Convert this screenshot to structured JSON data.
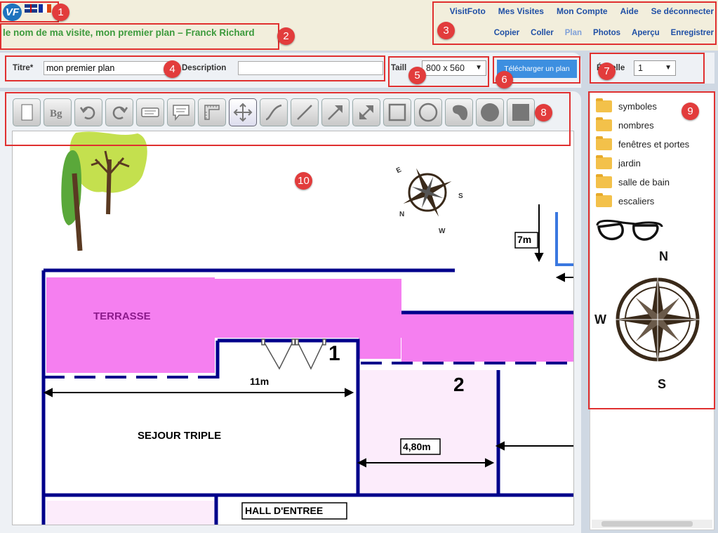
{
  "header": {
    "visit_title": "le nom de ma visite, mon premier plan – Franck Richard",
    "nav_top": [
      "VisitFoto",
      "Mes Visites",
      "Mon Compte",
      "Aide",
      "Se déconnecter"
    ],
    "nav_bottom": [
      "Copier",
      "Coller",
      "Plan",
      "Photos",
      "Aperçu",
      "Enregistrer"
    ],
    "active_nav": "Plan"
  },
  "form": {
    "title_label": "Titre*",
    "title_value": "mon premier plan",
    "description_label": "Description",
    "description_value": "",
    "size_label": "Taill",
    "size_value": "800 x 560",
    "upload_button": "Télécharger un plan",
    "scale_label": "Échelle",
    "scale_value": "1"
  },
  "toolbar": {
    "tools": [
      "blank-page-icon",
      "background-bg-icon",
      "undo-icon",
      "redo-icon",
      "text-box-icon",
      "speech-bubble-icon",
      "ruler-icon",
      "move-icon",
      "curve-icon",
      "line-icon",
      "arrow-icon",
      "double-arrow-icon",
      "square-icon",
      "circle-icon",
      "blob-shape-icon",
      "filled-circle-icon",
      "filled-square-icon"
    ],
    "active_tool": "move-icon"
  },
  "library": {
    "folders": [
      "symboles",
      "nombres",
      "fenêtres et portes",
      "jardin",
      "salle de bain",
      "escaliers"
    ],
    "compass_letters": [
      "N",
      "W",
      "S"
    ]
  },
  "plan": {
    "labels": {
      "terrasse": "TERRASSE",
      "room_1": "1",
      "room_2": "2",
      "dim_11m": "11m",
      "dim_7m": "7m",
      "dim_480": "4,80m",
      "sejour": "SEJOUR TRIPLE",
      "hall": "HALL D'ENTREE"
    },
    "compass_letters": [
      "E",
      "S",
      "N",
      "W"
    ]
  },
  "annotations": [
    "1",
    "2",
    "3",
    "4",
    "5",
    "6",
    "7",
    "8",
    "9",
    "10"
  ],
  "colors": {
    "accent": "#1f4fa5",
    "terrasse": "#f57ff0",
    "wall": "#00008b",
    "highlight": "#e03030"
  }
}
